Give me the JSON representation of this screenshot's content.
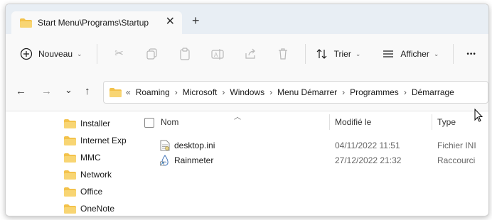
{
  "tab": {
    "title": "Start Menu\\Programs\\Startup",
    "close_glyph": "✕",
    "new_tab_glyph": "+"
  },
  "toolbar": {
    "new_label": "Nouveau",
    "sort_label": "Trier",
    "view_label": "Afficher",
    "more_glyph": "•••"
  },
  "nav": {
    "back": "←",
    "forward": "→",
    "recent": "⌄",
    "up": "↑"
  },
  "address": {
    "prefix": "«",
    "crumbs": [
      "Roaming",
      "Microsoft",
      "Windows",
      "Menu Démarrer",
      "Programmes",
      "Démarrage"
    ]
  },
  "sidebar": {
    "items": [
      {
        "label": "Installer"
      },
      {
        "label": "Internet Exp"
      },
      {
        "label": "MMC"
      },
      {
        "label": "Network"
      },
      {
        "label": "Office"
      },
      {
        "label": "OneNote"
      }
    ]
  },
  "columns": {
    "name": "Nom",
    "modified": "Modifié le",
    "type": "Type"
  },
  "files": [
    {
      "name": "desktop.ini",
      "modified": "04/11/2022 11:51",
      "type": "Fichier INI"
    },
    {
      "name": "Rainmeter",
      "modified": "27/12/2022 21:32",
      "type": "Raccourci"
    }
  ],
  "colors": {
    "folder": "#f3c24b",
    "accent": "#0067c0",
    "tabstrip": "#e8eef4"
  }
}
